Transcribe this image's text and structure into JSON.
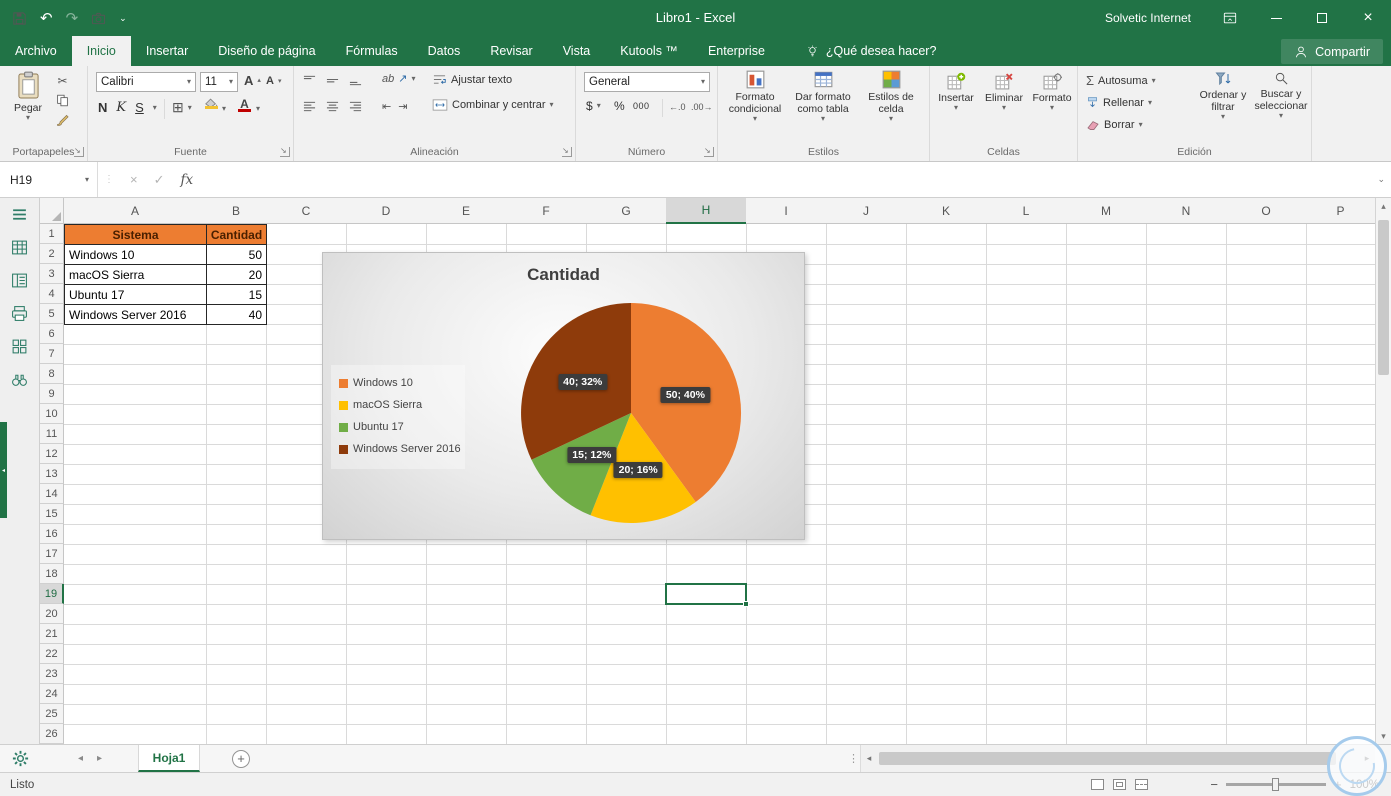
{
  "titlebar": {
    "title": "Libro1  -  Excel",
    "user": "Solvetic Internet"
  },
  "ribbon_tabs": [
    {
      "label": "Archivo",
      "active": false
    },
    {
      "label": "Inicio",
      "active": true
    },
    {
      "label": "Insertar",
      "active": false
    },
    {
      "label": "Diseño de página",
      "active": false
    },
    {
      "label": "Fórmulas",
      "active": false
    },
    {
      "label": "Datos",
      "active": false
    },
    {
      "label": "Revisar",
      "active": false
    },
    {
      "label": "Vista",
      "active": false
    },
    {
      "label": "Kutools ™",
      "active": false
    },
    {
      "label": "Enterprise",
      "active": false
    }
  ],
  "tellme": "¿Qué desea hacer?",
  "share_label": "Compartir",
  "ribbon": {
    "groups": [
      "Portapapeles",
      "Fuente",
      "Alineación",
      "Número",
      "Estilos",
      "Celdas",
      "Edición"
    ],
    "paste": "Pegar",
    "font_name": "Calibri",
    "font_size": "11",
    "bold": "N",
    "italic": "K",
    "underline": "S",
    "wrap_text": "Ajustar texto",
    "merge_center": "Combinar y centrar",
    "number_format": "General",
    "currency": "$",
    "percent": "%",
    "thousands": "000",
    "conditional_format": "Formato condicional",
    "format_as_table": "Dar formato como tabla",
    "cell_styles": "Estilos de celda",
    "insert": "Insertar",
    "delete": "Eliminar",
    "format": "Formato",
    "autosum": "Autosuma",
    "fill": "Rellenar",
    "clear": "Borrar",
    "sort_filter": "Ordenar y filtrar",
    "find_select": "Buscar y seleccionar"
  },
  "formula_bar": {
    "name_box": "H19",
    "fx": "fx"
  },
  "grid": {
    "columns": [
      "A",
      "B",
      "C",
      "D",
      "E",
      "F",
      "G",
      "H",
      "I",
      "J",
      "K",
      "L",
      "M",
      "N",
      "O",
      "P"
    ],
    "row_count": 26,
    "selected_col": "H",
    "selected_row": 19,
    "table": {
      "headers": [
        "Sistema",
        "Cantidad"
      ],
      "rows": [
        [
          "Windows 10",
          "50"
        ],
        [
          "macOS Sierra",
          "20"
        ],
        [
          "Ubuntu 17",
          "15"
        ],
        [
          "Windows Server 2016",
          "40"
        ]
      ]
    }
  },
  "chart_data": {
    "type": "pie",
    "title": "Cantidad",
    "categories": [
      "Windows 10",
      "macOS Sierra",
      "Ubuntu 17",
      "Windows Server 2016"
    ],
    "values": [
      50,
      20,
      15,
      40
    ],
    "data_labels": [
      "50; 40%",
      "20; 16%",
      "15; 12%",
      "40; 32%"
    ],
    "colors": [
      "#ED7D31",
      "#FFC000",
      "#70AD47",
      "#8E3B0B"
    ],
    "legend_position": "left"
  },
  "sheet": {
    "active_tab": "Hoja1"
  },
  "status_bar": {
    "mode": "Listo",
    "zoom": "100%"
  }
}
